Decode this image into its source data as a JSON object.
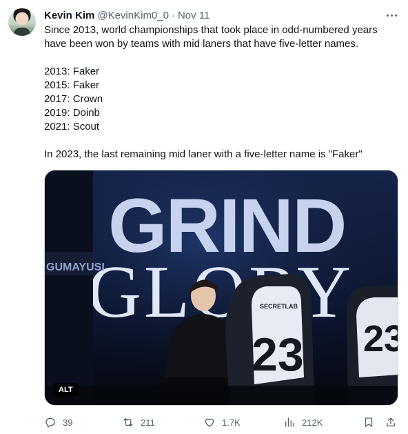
{
  "author": {
    "name": "Kevin Kim",
    "handle": "@KevinKim0_0",
    "separator": "·",
    "time": "Nov 11"
  },
  "tweet": {
    "line1": "Since 2013, world championships that took place in odd-numbered years have been won by teams with mid laners that have five-letter names.",
    "list": [
      "2013: Faker",
      "2015: Faker",
      "2017: Crown",
      "2019: Doinb",
      "2021: Scout"
    ],
    "closing": "In 2023, the last remaining mid laner with a five-letter name is \"Faker\""
  },
  "media": {
    "alt_label": "ALT",
    "banner_top": "GRIND",
    "banner_bottom": "GLORY",
    "sponsor_left": "GUMAYUSI",
    "chair_center_number": "23",
    "chair_right_number": "23",
    "chair_brand": "SECRETLAB"
  },
  "actions": {
    "replies": "39",
    "retweets": "211",
    "likes": "1.7K",
    "views": "212K"
  },
  "icons": {
    "more": "more-horizontal-icon",
    "reply": "reply-icon",
    "retweet": "retweet-icon",
    "like": "heart-icon",
    "views": "views-icon",
    "bookmark": "bookmark-icon",
    "share": "share-icon"
  },
  "colors": {
    "text": "#0f1419",
    "secondary": "#536471",
    "border": "#cfd9de"
  }
}
